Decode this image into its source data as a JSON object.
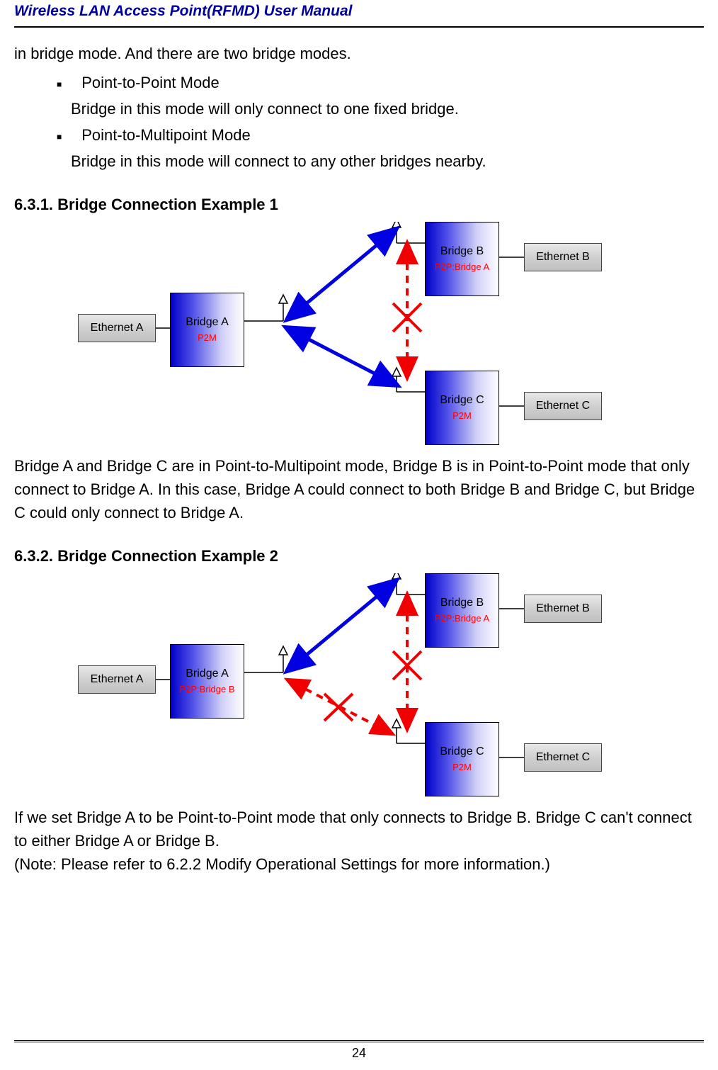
{
  "header": "Wireless LAN Access Point(RFMD) User Manual",
  "intro": "in bridge mode. And there are two bridge modes.",
  "bullets": {
    "p2p_title": "Point-to-Point Mode",
    "p2p_desc": "Bridge in this mode will only connect to one fixed bridge.",
    "p2m_title": "Point-to-Multipoint Mode",
    "p2m_desc": "Bridge in this mode will connect to any other bridges nearby."
  },
  "section1": {
    "title": "6.3.1. Bridge Connection Example 1",
    "ethA": "Ethernet A",
    "ethB": "Ethernet B",
    "ethC": "Ethernet C",
    "bridgeA_label": "Bridge A",
    "bridgeA_sub": "P2M",
    "bridgeB_label": "Bridge B",
    "bridgeB_sub": "P2P:Bridge A",
    "bridgeC_label": "Bridge C",
    "bridgeC_sub": "P2M",
    "desc": "Bridge A and Bridge C are in Point-to-Multipoint mode, Bridge B is in Point-to-Point mode that only connect to Bridge A. In this case, Bridge A could connect to both Bridge B and Bridge C, but Bridge C could only connect to Bridge A."
  },
  "section2": {
    "title": "6.3.2. Bridge Connection Example 2",
    "ethA": "Ethernet A",
    "ethB": "Ethernet B",
    "ethC": "Ethernet C",
    "bridgeA_label": "Bridge A",
    "bridgeA_sub": "P2P:Bridge B",
    "bridgeB_label": "Bridge B",
    "bridgeB_sub": "P2P:Bridge A",
    "bridgeC_label": "Bridge C",
    "bridgeC_sub": "P2M",
    "desc": "If we set Bridge A to be Point-to-Point mode that only connects to Bridge B. Bridge C can't connect to either Bridge A or Bridge B.",
    "note": "(Note: Please refer to 6.2.2 Modify Operational Settings for more information.)"
  },
  "page_number": "24"
}
